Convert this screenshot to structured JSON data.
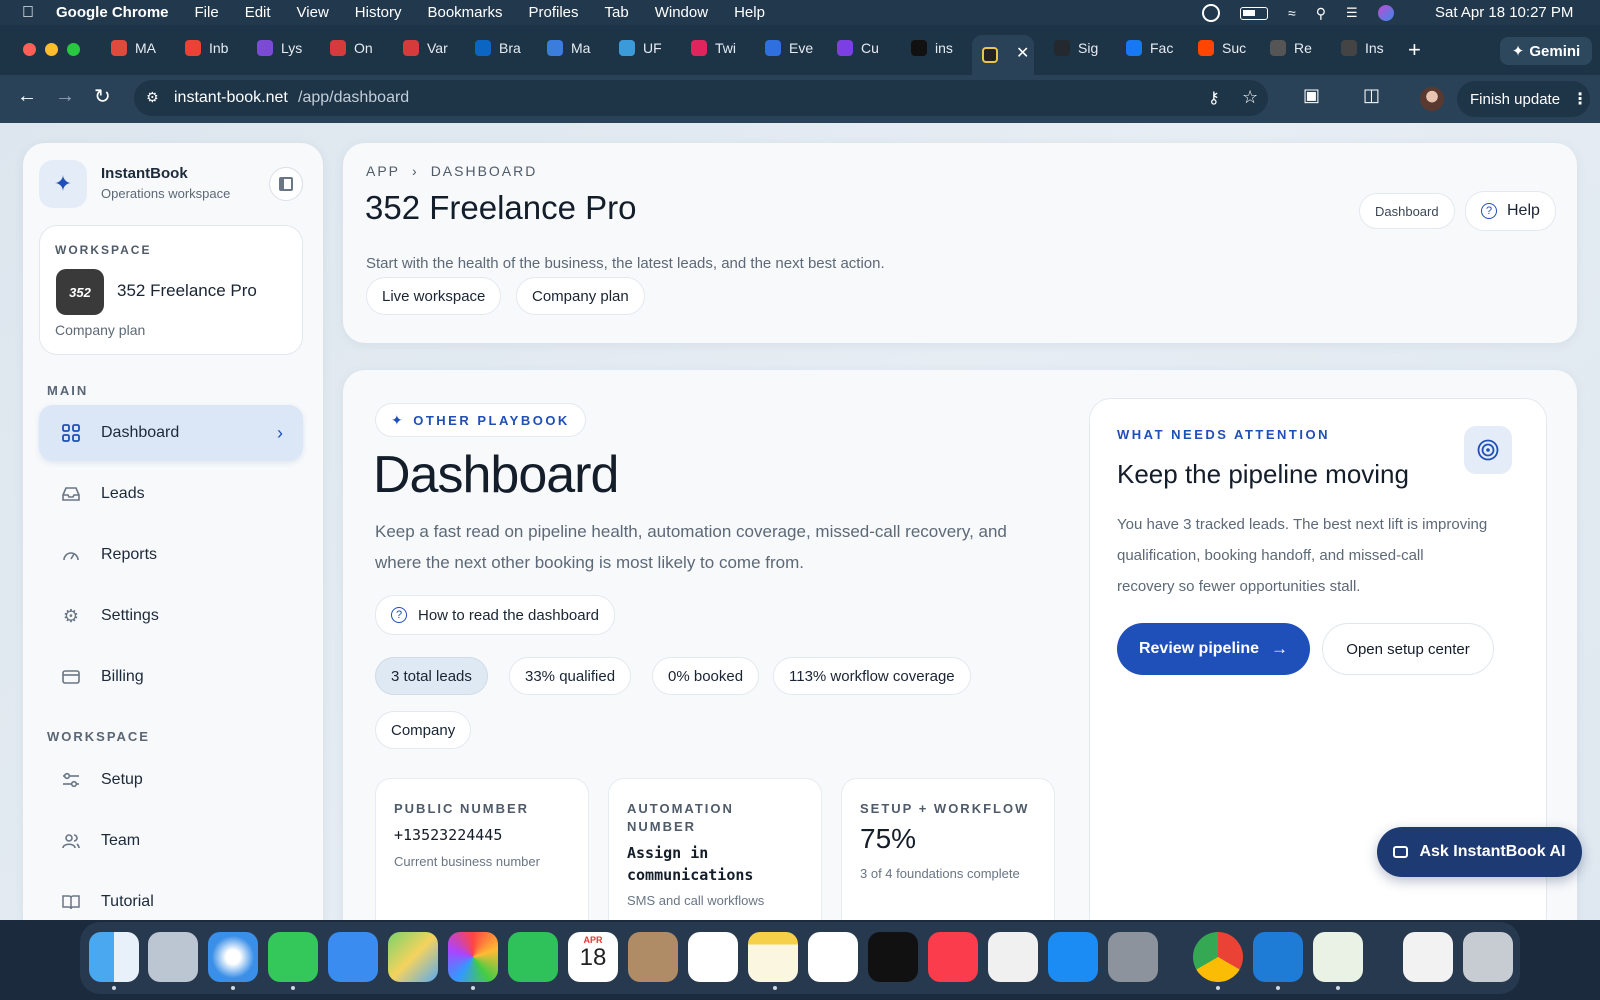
{
  "menubar": {
    "app_name": "Google Chrome",
    "menus": [
      "File",
      "Edit",
      "View",
      "History",
      "Bookmarks",
      "Profiles",
      "Tab",
      "Window",
      "Help"
    ],
    "datetime": "Sat Apr 18  10:27 PM"
  },
  "tabs": [
    {
      "label": "MA",
      "color": "#e04a3c"
    },
    {
      "label": "Inb",
      "color": "#ea4335"
    },
    {
      "label": "Lys",
      "color": "#7b4bd6"
    },
    {
      "label": "On",
      "color": "#d63b3b"
    },
    {
      "label": "Var",
      "color": "#d63b3b"
    },
    {
      "label": "Bra",
      "color": "#0a66c2"
    },
    {
      "label": "Ma",
      "color": "#3b7ddd"
    },
    {
      "label": "UF",
      "color": "#3b9ad9"
    },
    {
      "label": "Twi",
      "color": "#e0245e"
    },
    {
      "label": "Eve",
      "color": "#2f6fe0"
    },
    {
      "label": "Cu",
      "color": "#7b3fe4"
    },
    {
      "label": "ins",
      "color": "#111111"
    },
    {
      "label": "Sig",
      "color": "#24292f"
    },
    {
      "label": "Fac",
      "color": "#1877f2"
    },
    {
      "label": "Suc",
      "color": "#ff4500"
    },
    {
      "label": "Re",
      "color": "#555555"
    },
    {
      "label": "Ins",
      "color": "#444444"
    }
  ],
  "gemini_label": "Gemini",
  "address": {
    "host": "instant-book.net",
    "path": "/app/dashboard"
  },
  "finish_update": "Finish update",
  "sidebar": {
    "brand": "InstantBook",
    "brand_sub": "Operations workspace",
    "workspace_label": "WORKSPACE",
    "workspace_logo": "352",
    "workspace_name": "352 Freelance Pro",
    "workspace_plan": "Company plan",
    "main_label": "MAIN",
    "main_items": [
      {
        "label": "Dashboard",
        "icon": "grid-icon"
      },
      {
        "label": "Leads",
        "icon": "inbox-icon"
      },
      {
        "label": "Reports",
        "icon": "gauge-icon"
      },
      {
        "label": "Settings",
        "icon": "gear-icon"
      },
      {
        "label": "Billing",
        "icon": "card-icon"
      }
    ],
    "ws_label": "WORKSPACE",
    "ws_items": [
      {
        "label": "Setup",
        "icon": "sliders-icon"
      },
      {
        "label": "Team",
        "icon": "users-icon"
      },
      {
        "label": "Tutorial",
        "icon": "book-icon"
      }
    ]
  },
  "header": {
    "crumb_1": "APP",
    "crumb_2": "DASHBOARD",
    "title": "352 Freelance Pro",
    "subtitle": "Start with the health of the business, the latest leads, and the next best action.",
    "chip_1": "Live workspace",
    "chip_2": "Company plan",
    "dashboard_badge": "Dashboard",
    "help": "Help"
  },
  "main": {
    "playbook": "OTHER PLAYBOOK",
    "title": "Dashboard",
    "desc_1": "Keep a fast read on pipeline health, automation coverage, missed-call recovery, and",
    "desc_2": "where the next other booking is most likely to come from.",
    "how_to": "How to read the dashboard",
    "stats": [
      "3 total leads",
      "33% qualified",
      "0% booked",
      "113% workflow coverage",
      "Company"
    ],
    "tiles": [
      {
        "label_1": "PUBLIC NUMBER",
        "label_2": "",
        "value": "+13523224445",
        "sub": "Current business number"
      },
      {
        "label_1": "AUTOMATION",
        "label_2": "NUMBER",
        "value_1": "Assign in",
        "value_2": "communications",
        "sub": "SMS and call workflows"
      },
      {
        "label_1": "SETUP + WORKFLOW",
        "label_2": "",
        "value": "75%",
        "sub": "3 of 4 foundations complete"
      }
    ]
  },
  "attention": {
    "label": "WHAT NEEDS ATTENTION",
    "title": "Keep the pipeline moving",
    "line_1": "You have 3 tracked leads. The best next lift is improving",
    "line_2": "qualification, booking handoff, and missed-call",
    "line_3": "recovery so fewer opportunities stall.",
    "primary": "Review pipeline",
    "secondary": "Open setup center"
  },
  "ask_ai": "Ask InstantBook AI",
  "dock_calendar": {
    "month": "APR",
    "day": "18"
  },
  "colors": {
    "accent": "#1f4fb8",
    "accent_dark": "#163a8a",
    "sidebar_active": "#dbe7f7",
    "chrome_dark": "#1d3346"
  }
}
